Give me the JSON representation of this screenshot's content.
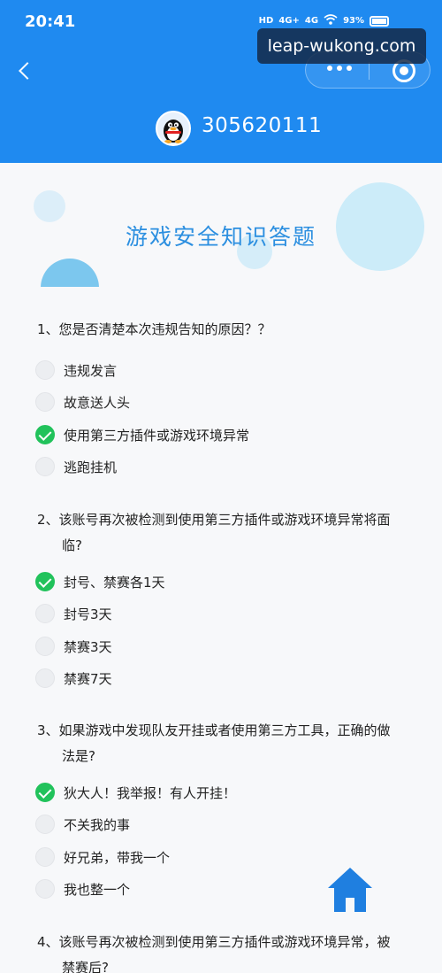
{
  "status_bar": {
    "time": "20:41",
    "signal_labels": [
      "HD",
      "4G+",
      "4G"
    ],
    "battery": "93%"
  },
  "watermark": "leap-wukong.com",
  "header": {
    "account_number": "305620111",
    "background_color": "#1f8af0"
  },
  "page_title": "游戏安全知识答题",
  "questions": [
    {
      "text": "1、您是否清楚本次违规告知的原因？？",
      "text_line2": "",
      "options": [
        {
          "label": "违规发言",
          "checked": false
        },
        {
          "label": "故意送人头",
          "checked": false
        },
        {
          "label": "使用第三方插件或游戏环境异常",
          "checked": true
        },
        {
          "label": "逃跑挂机",
          "checked": false
        }
      ]
    },
    {
      "text": "2、该账号再次被检测到使用第三方插件或游戏环境异常将面",
      "text_line2": "临?",
      "options": [
        {
          "label": "封号、禁赛各1天",
          "checked": true
        },
        {
          "label": "封号3天",
          "checked": false
        },
        {
          "label": "禁赛3天",
          "checked": false
        },
        {
          "label": "禁赛7天",
          "checked": false
        }
      ]
    },
    {
      "text": "3、如果游戏中发现队友开挂或者使用第三方工具，正确的做",
      "text_line2": "法是?",
      "options": [
        {
          "label": "狄大人！我举报！有人开挂！",
          "checked": true
        },
        {
          "label": "不关我的事",
          "checked": false
        },
        {
          "label": "好兄弟，带我一个",
          "checked": false
        },
        {
          "label": "我也整一个",
          "checked": false
        }
      ]
    },
    {
      "text": "4、该账号再次被检测到使用第三方插件或游戏环境异常，被",
      "text_line2": "禁赛后?",
      "options": []
    }
  ],
  "colors": {
    "accent": "#2c8fe0",
    "checked": "#21c25b"
  }
}
